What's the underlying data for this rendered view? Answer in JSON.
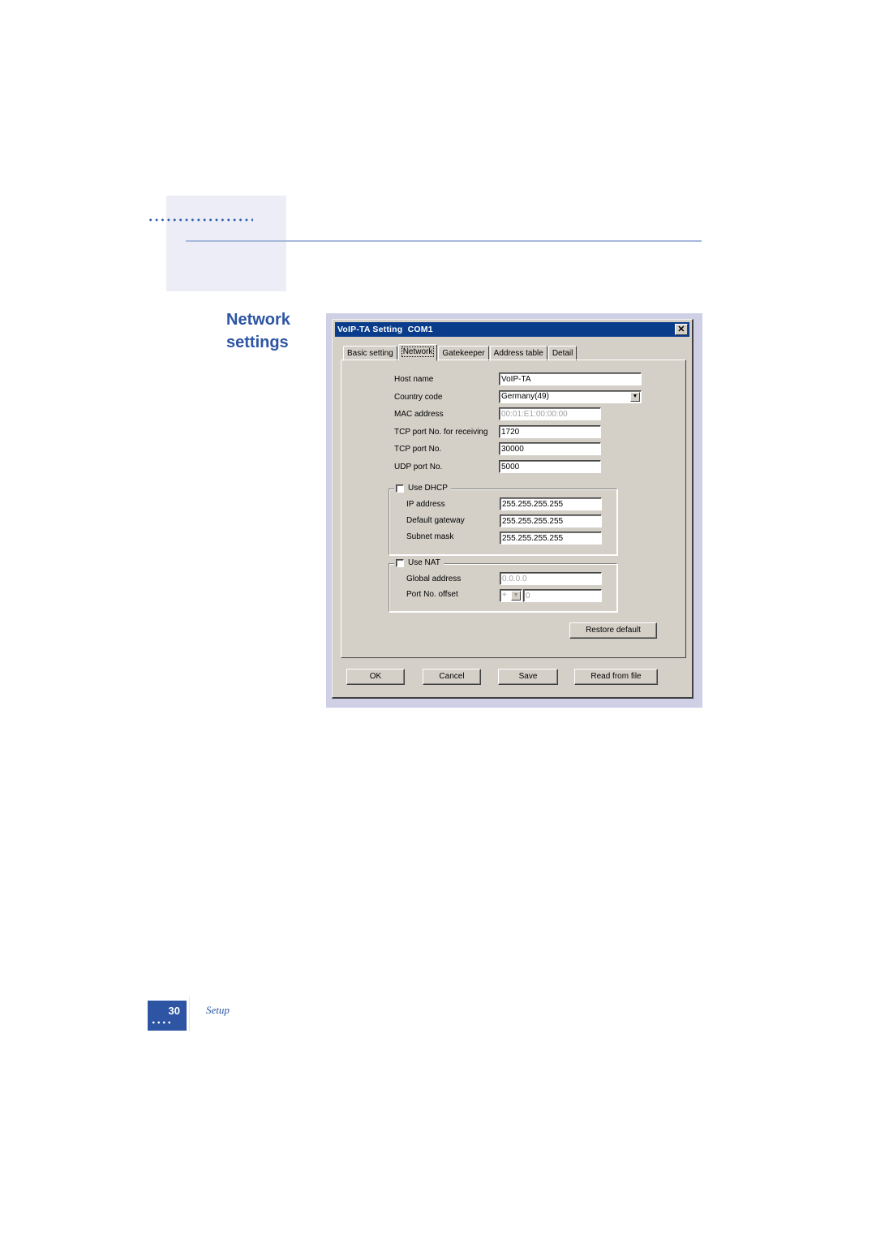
{
  "page": {
    "section_heading": "Network settings",
    "footer": {
      "page_number": "30",
      "section_name": "Setup"
    }
  },
  "dialog": {
    "title": "VoIP-TA Setting  COM1",
    "close_icon": "close-icon",
    "tabs": [
      {
        "label": "Basic setting",
        "active": false
      },
      {
        "label": "Network",
        "active": true
      },
      {
        "label": "Gatekeeper",
        "active": false
      },
      {
        "label": "Address table",
        "active": false
      },
      {
        "label": "Detail",
        "active": false
      }
    ],
    "fields": {
      "host_name": {
        "label": "Host name",
        "value": "VoIP-TA"
      },
      "country_code": {
        "label": "Country code",
        "value": "Germany(49)"
      },
      "mac_address": {
        "label": "MAC address",
        "value": "00:01:E1:00:00:00",
        "disabled": true
      },
      "tcp_port_receiving": {
        "label": "TCP port No. for receiving",
        "value": "1720"
      },
      "tcp_port": {
        "label": "TCP port No.",
        "value": "30000"
      },
      "udp_port": {
        "label": "UDP port No.",
        "value": "5000"
      }
    },
    "dhcp": {
      "label": "Use DHCP",
      "checked": false,
      "ip_address": {
        "label": "IP address",
        "value": "255.255.255.255"
      },
      "default_gateway": {
        "label": "Default gateway",
        "value": "255.255.255.255"
      },
      "subnet_mask": {
        "label": "Subnet mask",
        "value": "255.255.255.255"
      }
    },
    "nat": {
      "label": "Use NAT",
      "checked": false,
      "global_address": {
        "label": "Global address",
        "value": "0.0.0.0",
        "disabled": true
      },
      "port_offset": {
        "label": "Port No. offset",
        "sign": "+",
        "value": "0",
        "disabled": true
      }
    },
    "buttons": {
      "restore_default": "Restore default",
      "ok": "OK",
      "cancel": "Cancel",
      "save": "Save",
      "read_from_file": "Read from file"
    },
    "colors": {
      "titlebar": "#0a3c8c",
      "face": "#d4d0c8",
      "heading_blue": "#2d55a3"
    }
  }
}
